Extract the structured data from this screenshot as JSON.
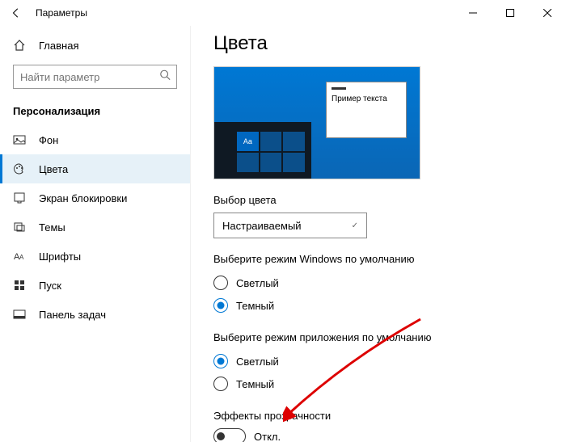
{
  "titlebar": {
    "title": "Параметры"
  },
  "sidebar": {
    "home": "Главная",
    "search_placeholder": "Найти параметр",
    "section": "Персонализация",
    "items": [
      {
        "label": "Фон"
      },
      {
        "label": "Цвета"
      },
      {
        "label": "Экран блокировки"
      },
      {
        "label": "Темы"
      },
      {
        "label": "Шрифты"
      },
      {
        "label": "Пуск"
      },
      {
        "label": "Панель задач"
      }
    ]
  },
  "main": {
    "heading": "Цвета",
    "preview_sample_text": "Пример текста",
    "preview_aa": "Aa",
    "color_mode_label": "Выбор цвета",
    "color_mode_value": "Настраиваемый",
    "windows_mode_label": "Выберите режим Windows по умолчанию",
    "windows_mode_options": {
      "light": "Светлый",
      "dark": "Темный"
    },
    "app_mode_label": "Выберите режим приложения по умолчанию",
    "app_mode_options": {
      "light": "Светлый",
      "dark": "Темный"
    },
    "transparency_label": "Эффекты прозрачности",
    "transparency_state": "Откл."
  }
}
